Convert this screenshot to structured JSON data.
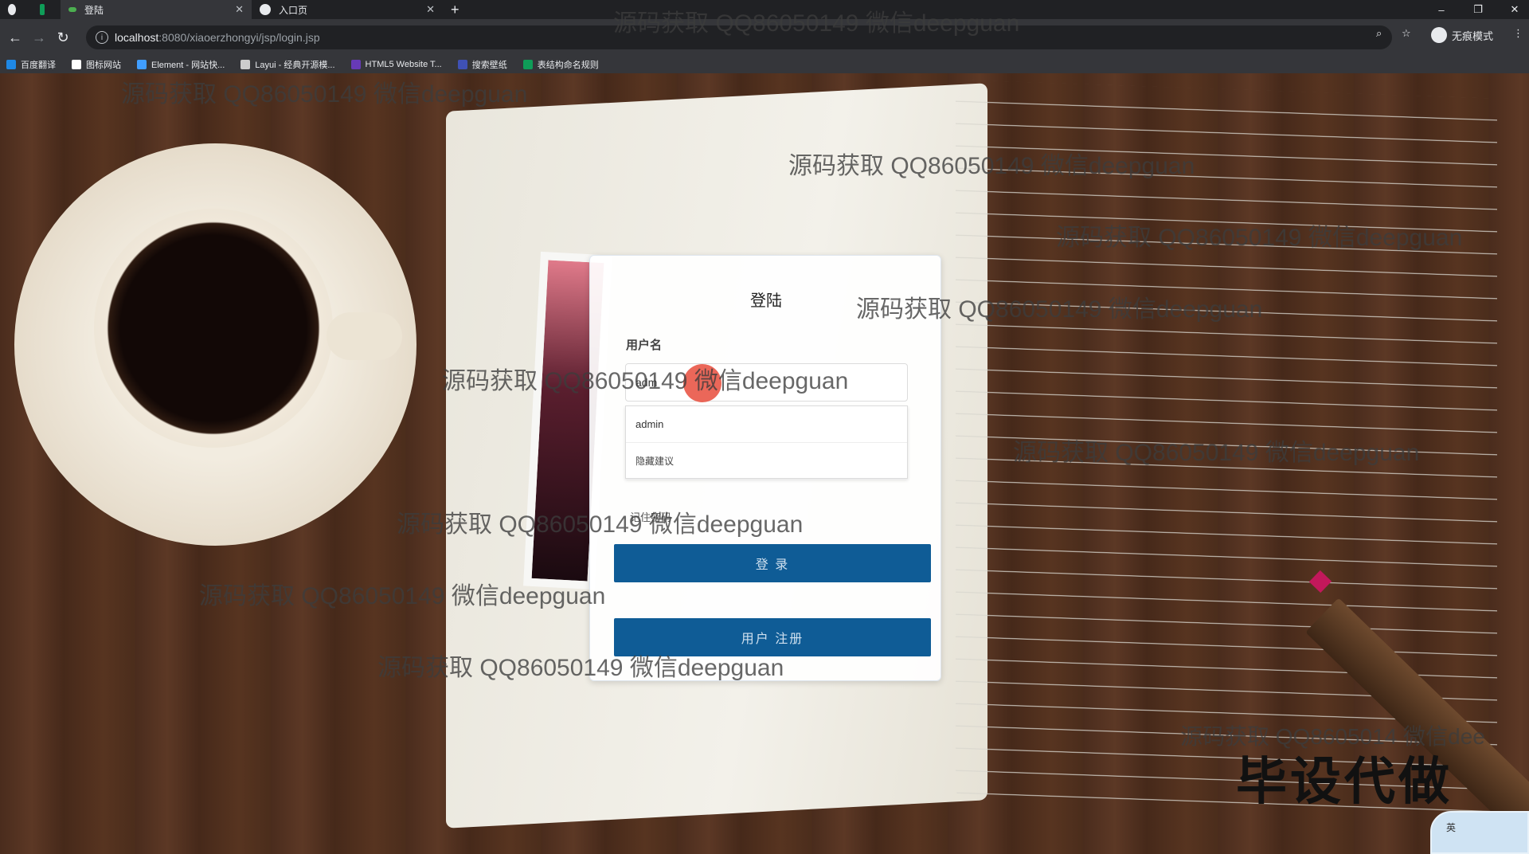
{
  "browser": {
    "tabs": [
      {
        "label": "登陆",
        "active": true
      },
      {
        "label": "入口页",
        "active": false
      }
    ],
    "url_host": "localhost",
    "url_path": ":8080/xiaoerzhongyi/jsp/login.jsp",
    "profile_label": "无痕模式",
    "bookmarks": [
      {
        "label": "百度翻译",
        "icon": "translate-icon",
        "color": "#1e88e5"
      },
      {
        "label": "图标网站",
        "icon": "flag-icon",
        "color": "#ffffff"
      },
      {
        "label": "Element - 网站快...",
        "icon": "element-icon",
        "color": "#409eff"
      },
      {
        "label": "Layui - 经典开源模...",
        "icon": "layui-icon",
        "color": "#cccccc"
      },
      {
        "label": "HTML5 Website T...",
        "icon": "html5-icon",
        "color": "#673ab7"
      },
      {
        "label": "搜索壁纸",
        "icon": "wallpaper-icon",
        "color": "#3f51b5"
      },
      {
        "label": "表结构命名规则",
        "icon": "sheet-icon",
        "color": "#0f9d58"
      }
    ]
  },
  "login": {
    "title": "登陆",
    "username_label": "用户名",
    "username_value": "adm",
    "autocomplete": [
      "admin",
      "隐藏建议"
    ],
    "remember_label": "记住密码",
    "login_button": "登 录",
    "register_button": "用户 注册"
  },
  "watermark": "源码获取 QQ86050149 微信deepguan",
  "watermark_clipped": "源码获取 QQ8605014",
  "watermark_clipped_tail": "微信dee",
  "promo_text": "毕设代做",
  "ime_label": "英"
}
